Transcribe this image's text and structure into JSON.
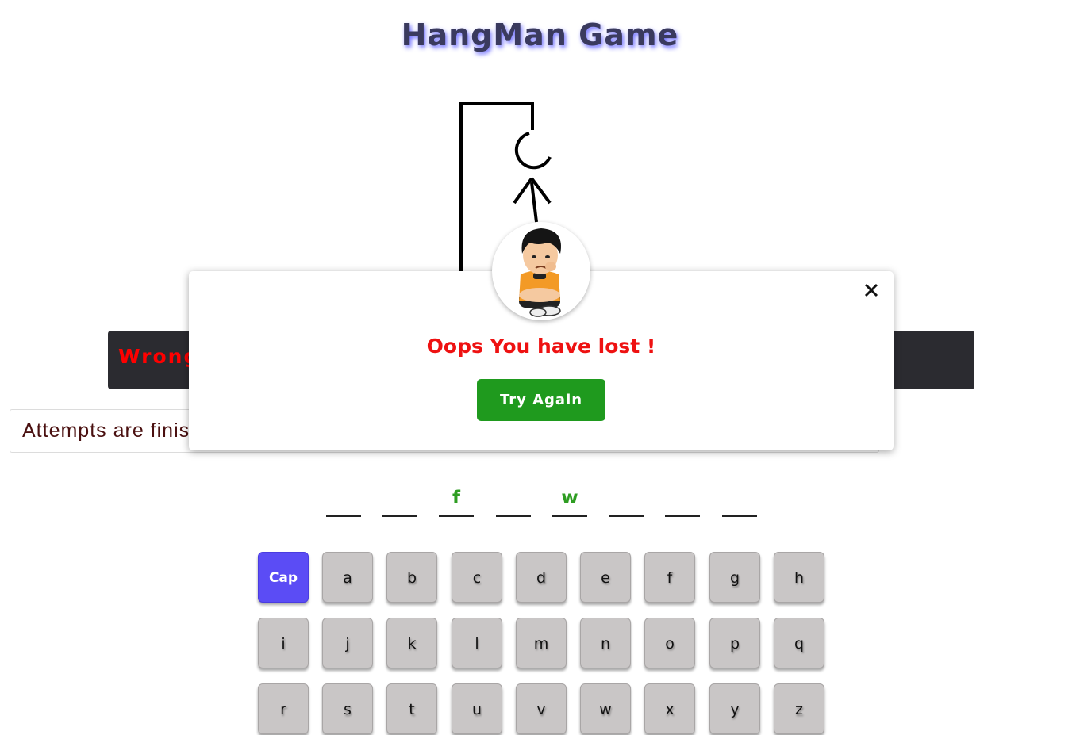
{
  "page": {
    "title": "HangMan Game"
  },
  "status": {
    "wrong_label": "Wrong",
    "attempts_text": "Attempts are finis"
  },
  "word": {
    "slots": [
      "",
      "",
      "f",
      "",
      "w",
      "",
      "",
      ""
    ]
  },
  "keyboard": {
    "keys": [
      "Cap",
      "a",
      "b",
      "c",
      "d",
      "e",
      "f",
      "g",
      "h",
      "i",
      "j",
      "k",
      "l",
      "m",
      "n",
      "o",
      "p",
      "q",
      "r",
      "s",
      "t",
      "u",
      "v",
      "w",
      "x",
      "y",
      "z"
    ]
  },
  "modal": {
    "message": "Oops You have lost !",
    "button_label": "Try Again",
    "close_icon": "close-icon",
    "avatar_icon": "sad-boy-avatar"
  },
  "colors": {
    "title_shadow": "#6d6dff",
    "wrong_text": "#ff0000",
    "guessed_letter": "#2e9d22",
    "cap_key": "#5b4cf5",
    "key_bg": "#c9c6c6",
    "lost_text": "#ee1111",
    "try_button": "#1f9a1e"
  }
}
